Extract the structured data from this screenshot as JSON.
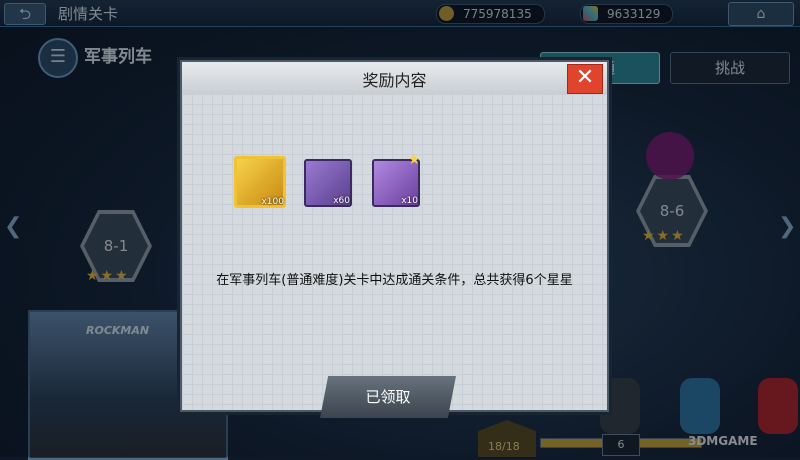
{
  "header": {
    "back_icon": "back-arrow-icon",
    "title": "剧情关卡",
    "gold": "775978135",
    "gems": "9633129",
    "home_icon": "home-icon"
  },
  "stage": {
    "menu_icon": "list-icon",
    "name": "军事列车",
    "tabs": [
      "普通",
      "挑战"
    ]
  },
  "nodes": [
    {
      "label": "8-1",
      "stars": "★★★"
    },
    {
      "label": "8-6",
      "stars": "★★★"
    }
  ],
  "preview_text": "ROCKMAN",
  "progress": {
    "text": "18/18",
    "current": "6",
    "fill": 1.0
  },
  "watermark": "3DMGAME",
  "dialog": {
    "title": "奖励内容",
    "close": "✕",
    "rewards": [
      {
        "icon": "rainbow-crystal-icon",
        "qty": "x100"
      },
      {
        "icon": "bolt-screw-icon",
        "qty": "x60"
      },
      {
        "icon": "character-portrait-icon",
        "qty": "x10"
      }
    ],
    "condition": "在军事列车(普通难度)关卡中达成通关条件，总共获得6个星星",
    "claim_label": "已领取"
  },
  "colors": {
    "accent": "#e1442c",
    "tab_active": "#2f8b9b",
    "star": "#f3c23a"
  }
}
